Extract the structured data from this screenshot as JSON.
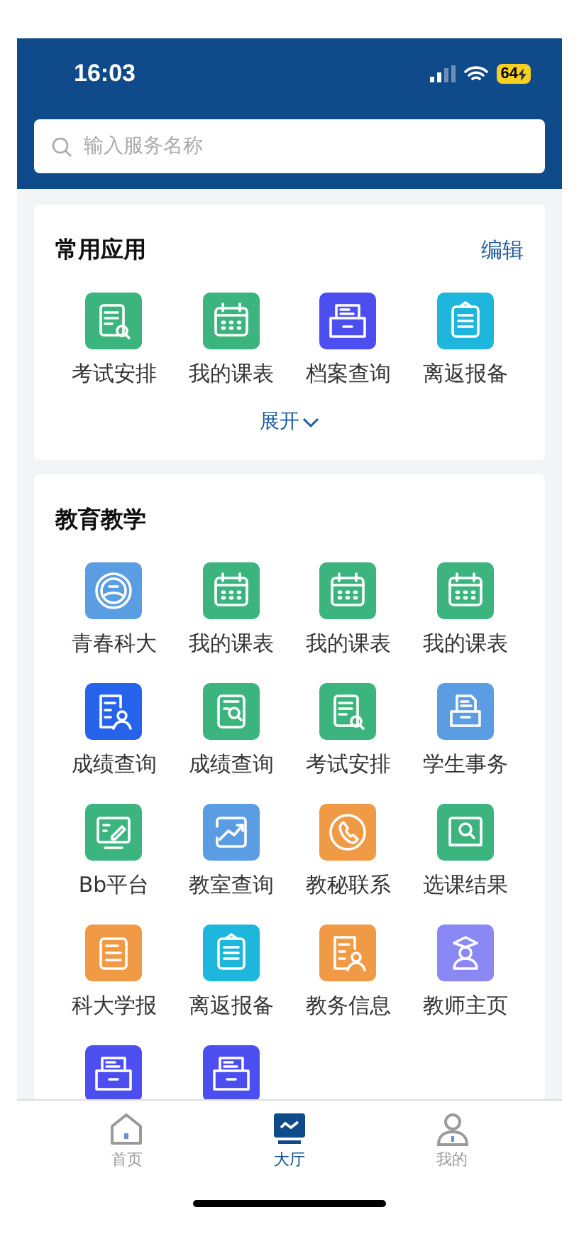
{
  "status_bar": {
    "time": "16:03",
    "battery": "64"
  },
  "search": {
    "placeholder": "输入服务名称"
  },
  "common": {
    "title": "常用应用",
    "edit": "编辑",
    "expand": "展开",
    "items": [
      {
        "label": "考试安排",
        "kind": "list-search",
        "color": "#3bb47e"
      },
      {
        "label": "我的课表",
        "kind": "calendar",
        "color": "#3bb47e"
      },
      {
        "label": "档案查询",
        "kind": "tray",
        "color": "#4c4ef0"
      },
      {
        "label": "离返报备",
        "kind": "clipboard",
        "color": "#1eb6dc"
      }
    ]
  },
  "education": {
    "title": "教育教学",
    "items": [
      {
        "label": "青春科大",
        "kind": "emblem",
        "color": "#5b9de3"
      },
      {
        "label": "我的课表",
        "kind": "calendar",
        "color": "#3bb47e"
      },
      {
        "label": "我的课表",
        "kind": "calendar",
        "color": "#3bb47e"
      },
      {
        "label": "我的课表",
        "kind": "calendar",
        "color": "#3bb47e"
      },
      {
        "label": "成绩查询",
        "kind": "person-doc",
        "color": "#2563eb"
      },
      {
        "label": "成绩查询",
        "kind": "doc-search",
        "color": "#3bb47e"
      },
      {
        "label": "考试安排",
        "kind": "list-search",
        "color": "#3bb47e"
      },
      {
        "label": "学生事务",
        "kind": "tray-doc",
        "color": "#5b9de3"
      },
      {
        "label": "Bb平台",
        "kind": "board-pen",
        "color": "#3bb47e"
      },
      {
        "label": "教室查询",
        "kind": "chart",
        "color": "#5b9de3"
      },
      {
        "label": "教秘联系",
        "kind": "phone",
        "color": "#f09a45"
      },
      {
        "label": "选课结果",
        "kind": "board-search",
        "color": "#3bb47e"
      },
      {
        "label": "科大学报",
        "kind": "doc",
        "color": "#f09a45"
      },
      {
        "label": "离返报备",
        "kind": "clipboard",
        "color": "#1eb6dc"
      },
      {
        "label": "教务信息",
        "kind": "person-doc",
        "color": "#f09a45"
      },
      {
        "label": "教师主页",
        "kind": "teacher",
        "color": "#8a88f5"
      },
      {
        "kind": "tray",
        "color": "#4c4ef0"
      },
      {
        "kind": "tray",
        "color": "#4c4ef0"
      }
    ]
  },
  "tab_bar": [
    {
      "label": "首页",
      "kind": "home",
      "selected": false
    },
    {
      "label": "大厅",
      "kind": "hall",
      "selected": true
    },
    {
      "label": "我的",
      "kind": "user",
      "selected": false
    }
  ]
}
